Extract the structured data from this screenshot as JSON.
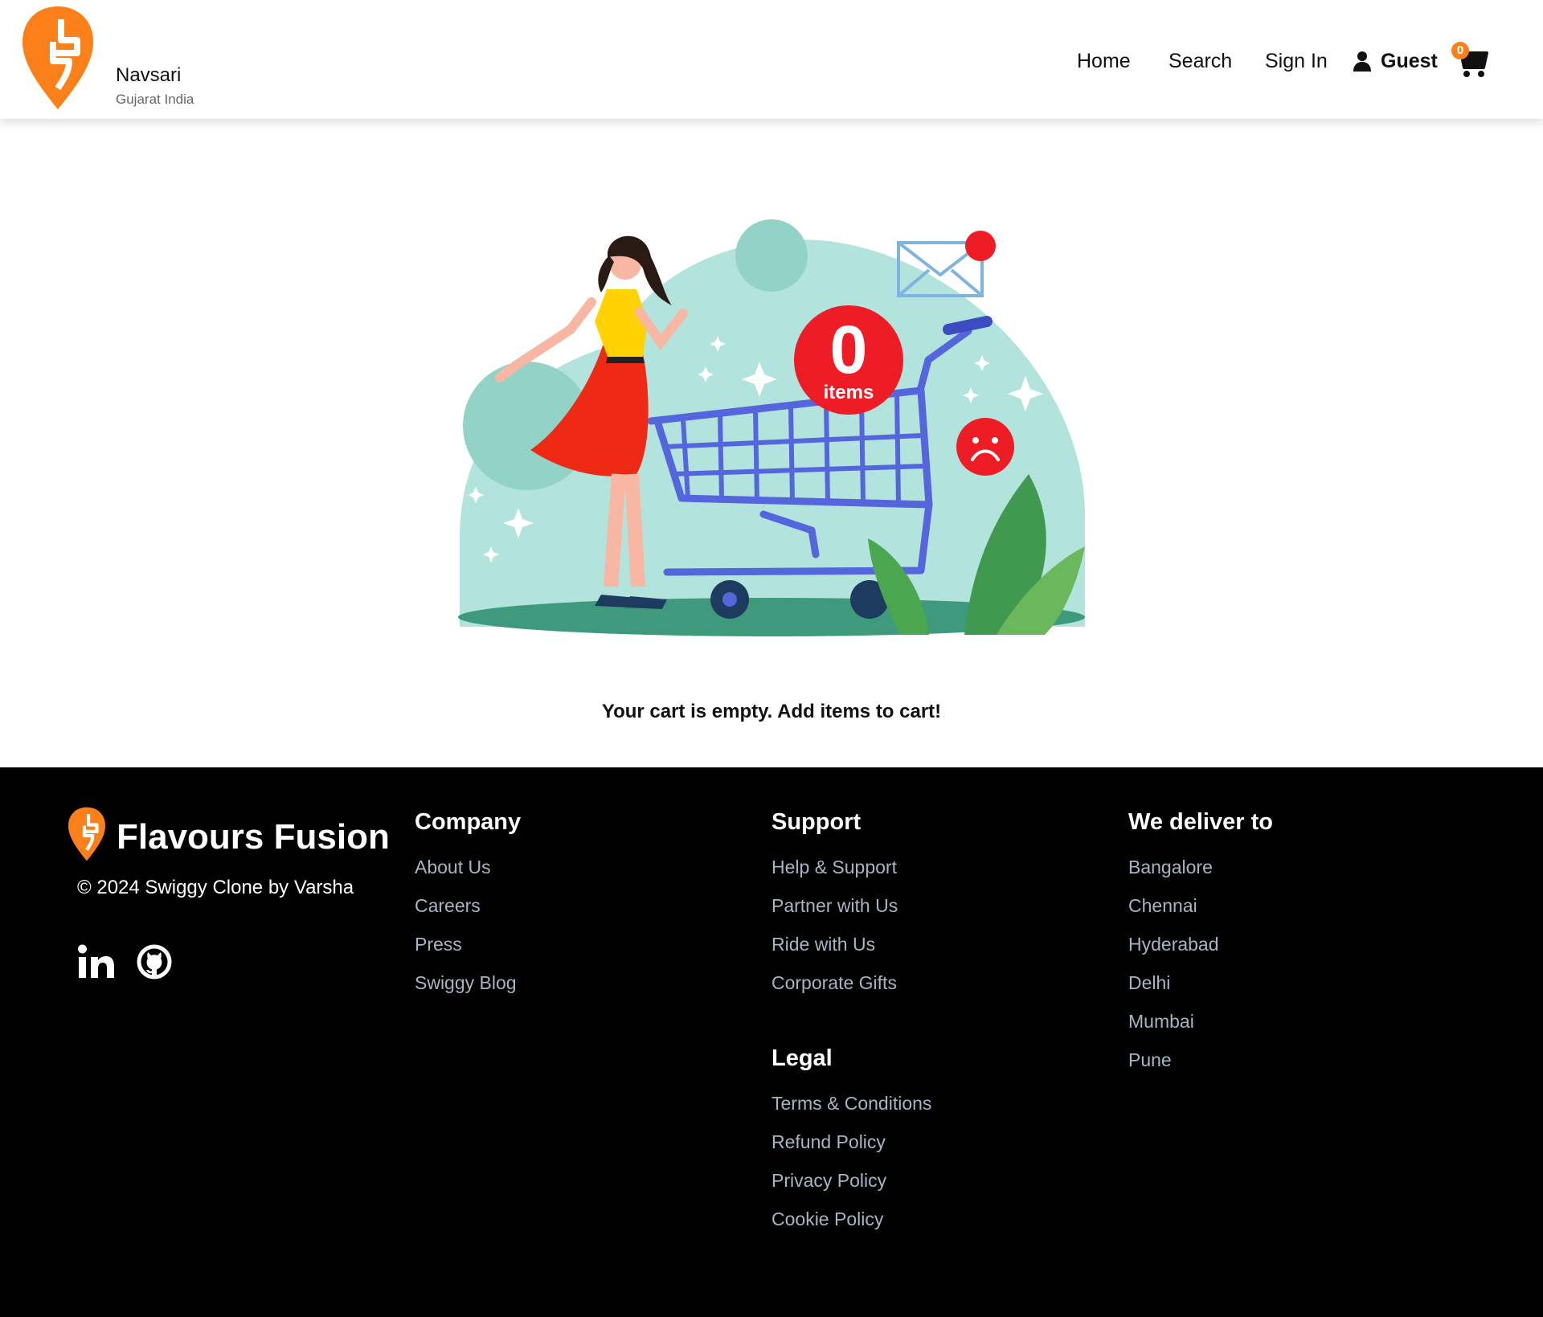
{
  "header": {
    "location_city": "Navsari",
    "location_state": "Gujarat India",
    "nav": {
      "home": "Home",
      "search": "Search",
      "sign_in": "Sign In"
    },
    "user_label": "Guest",
    "cart_count": "0"
  },
  "main": {
    "illustration_badge_number": "0",
    "illustration_badge_text": "items",
    "empty_message": "Your cart is empty. Add items to cart!"
  },
  "footer": {
    "brand": "Flavours Fusion",
    "copyright": "© 2024 Swiggy Clone by Varsha",
    "company": {
      "title": "Company",
      "links": [
        "About Us",
        "Careers",
        "Press",
        "Swiggy Blog"
      ]
    },
    "support": {
      "title": "Support",
      "links": [
        "Help & Support",
        "Partner with Us",
        "Ride with Us",
        "Corporate Gifts"
      ]
    },
    "legal": {
      "title": "Legal",
      "links": [
        "Terms & Conditions",
        "Refund Policy",
        "Privacy Policy",
        "Cookie Policy"
      ]
    },
    "deliver": {
      "title": "We deliver to",
      "links": [
        "Bangalore",
        "Chennai",
        "Hyderabad",
        "Delhi",
        "Mumbai",
        "Pune"
      ]
    }
  },
  "colors": {
    "brand_orange": "#fc8019",
    "footer_bg": "#000000",
    "footer_link": "#a8b3c4",
    "badge_red": "#ee1c25"
  },
  "icons": [
    "swiggy-logo-icon",
    "user-icon",
    "cart-icon",
    "linkedin-icon",
    "github-icon"
  ]
}
